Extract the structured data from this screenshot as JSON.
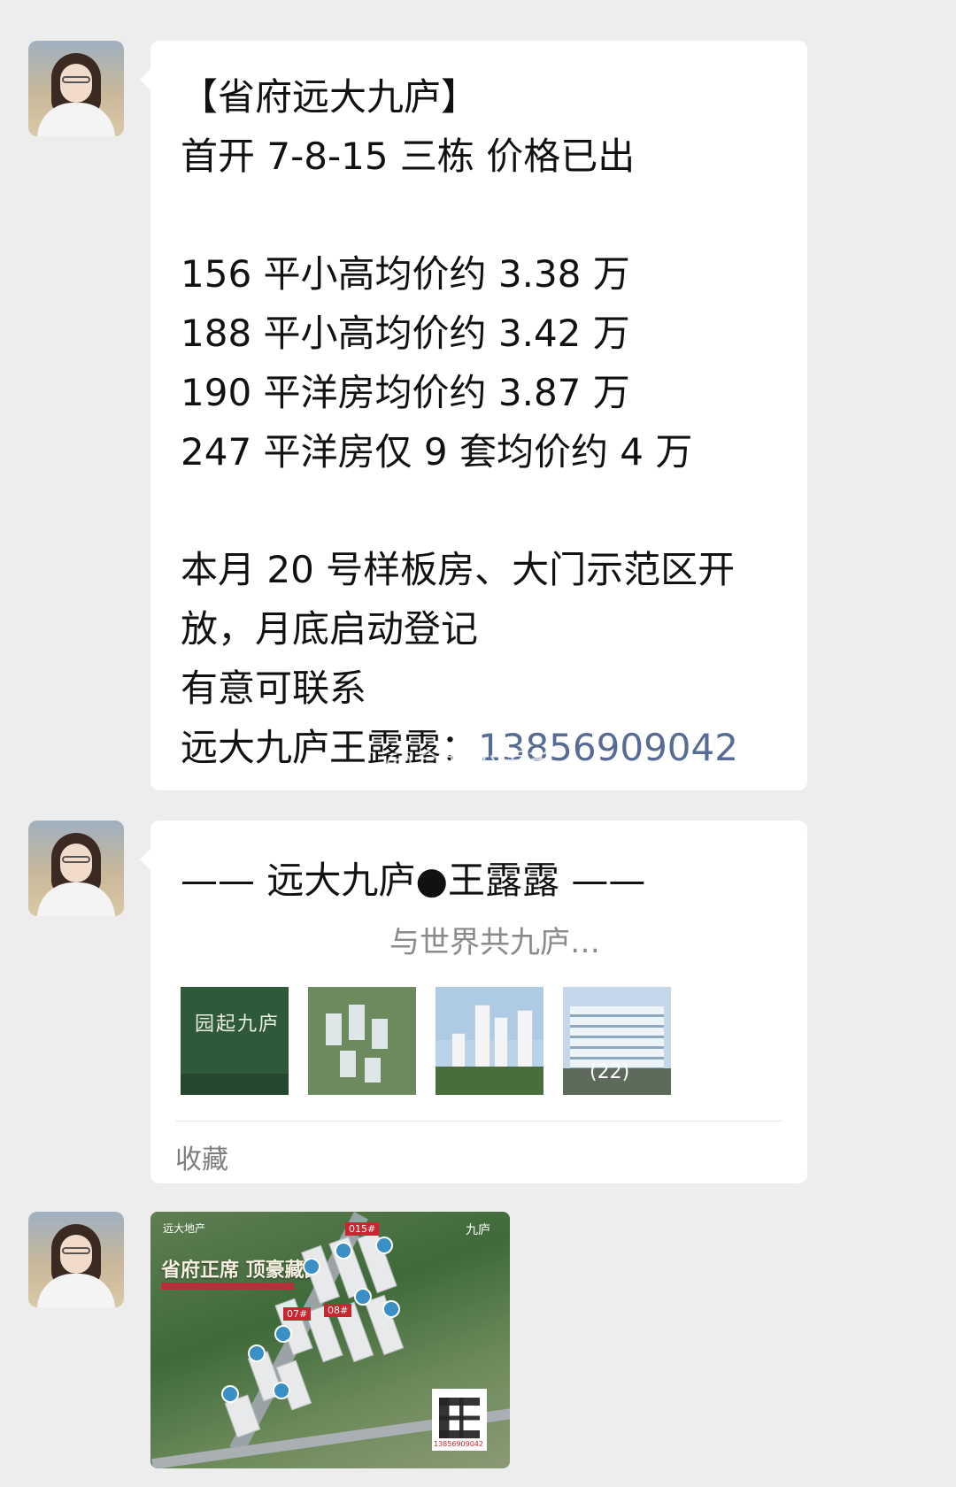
{
  "messages": [
    {
      "id": "msg1",
      "type": "text",
      "lines": [
        "【省府远大九庐】",
        "首开 7-8-15 三栋 价格已出",
        "",
        "156 平小高均价约 3.38 万",
        "188 平小高均价约 3.42 万",
        "190 平洋房均价约 3.87 万",
        "247 平洋房仅 9 套均价约 4 万",
        "",
        "本月 20 号样板房、大门示范区开",
        "放，月底启动登记",
        "有意可联系",
        "远大九庐王露露："
      ],
      "phone": "13856909042",
      "watermark": "@合肥小表弟"
    },
    {
      "id": "msg2",
      "type": "favorite-card",
      "title": "—— 远大九庐●王露露 ——",
      "subtitle": "与世界共九庐…",
      "thumb1_text": "园起九庐",
      "image_count": "(22)",
      "footer": "收藏"
    },
    {
      "id": "msg3",
      "type": "image",
      "slogan": "省府正席 顶豪藏品",
      "brand_left": "远大地产",
      "brand_right": "九庐",
      "tags": [
        "015#",
        "07#",
        "08#"
      ],
      "qr_label": "13856909042"
    }
  ]
}
